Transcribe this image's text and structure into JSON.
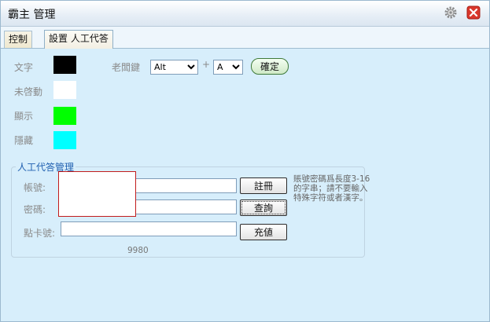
{
  "window": {
    "title": "霸主 管理"
  },
  "tabs": [
    {
      "label": "控制"
    },
    {
      "label": "設置 人工代答"
    }
  ],
  "colors": {
    "text": "#000000",
    "inactive": "#ffffff",
    "show": "#00ff00",
    "hide": "#00ffff"
  },
  "color_labels": {
    "text": "文字",
    "inactive": "未啓動",
    "show": "顯示",
    "hide": "隱藏"
  },
  "hotkey": {
    "label": "老闆鍵",
    "modifier": "Alt",
    "plus": "+",
    "key": "A",
    "confirm_label": "確定"
  },
  "manual": {
    "legend": "人工代答管理",
    "account_label": "帳號:",
    "password_label": "密碼:",
    "card_label": "點卡號:",
    "register_label": "註冊",
    "query_label": "查詢",
    "recharge_label": "充値",
    "note": "賬號密碼爲長度3-16的字串；請不要輸入特殊字符或者漢字。",
    "count": "9980"
  }
}
